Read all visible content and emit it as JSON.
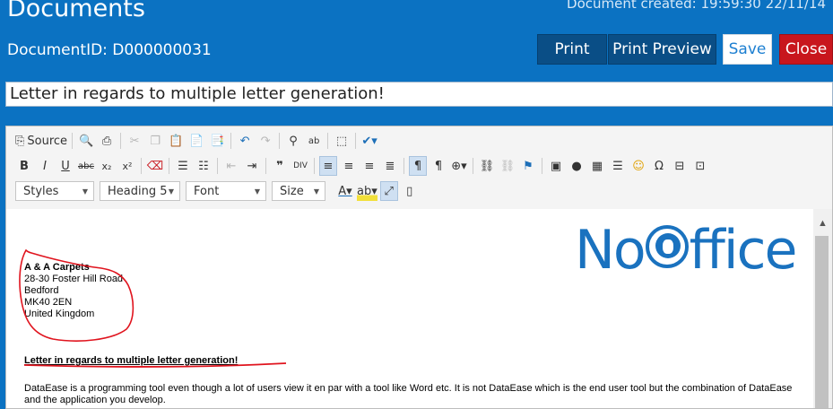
{
  "window": {
    "title": "Documents",
    "created_label": "Document created:  19:59:30  22/11/14",
    "docid_label": "DocumentID: D000000031"
  },
  "actions": {
    "print": "Print",
    "print_preview": "Print Preview",
    "save": "Save",
    "close": "Close"
  },
  "subject": {
    "value": "Letter in regards to multiple letter generation!"
  },
  "toolbar": {
    "source_label": "Source",
    "styles_label": "Styles",
    "format_label": "Heading 5",
    "font_label": "Font",
    "size_label": "Size"
  },
  "document": {
    "logo_text_left": "No",
    "logo_text_right": "ffice",
    "address": [
      "A & A Carpets",
      "28-30 Foster Hill Road",
      "Bedford",
      "MK40 2EN",
      "United Kingdom"
    ],
    "heading": "Letter in regards to multiple letter generation!",
    "paragraph": "DataEase is a programming tool even though a lot of users view it en par with a tool like Word etc. It is not DataEase which is the end user tool but the combination of DataEase and the application you develop."
  },
  "colors": {
    "header_bg": "#0b72c2",
    "primary_button": "#0a4e86",
    "close_button": "#c8161d",
    "logo": "#1a72bf",
    "annotation": "#e0141e"
  }
}
